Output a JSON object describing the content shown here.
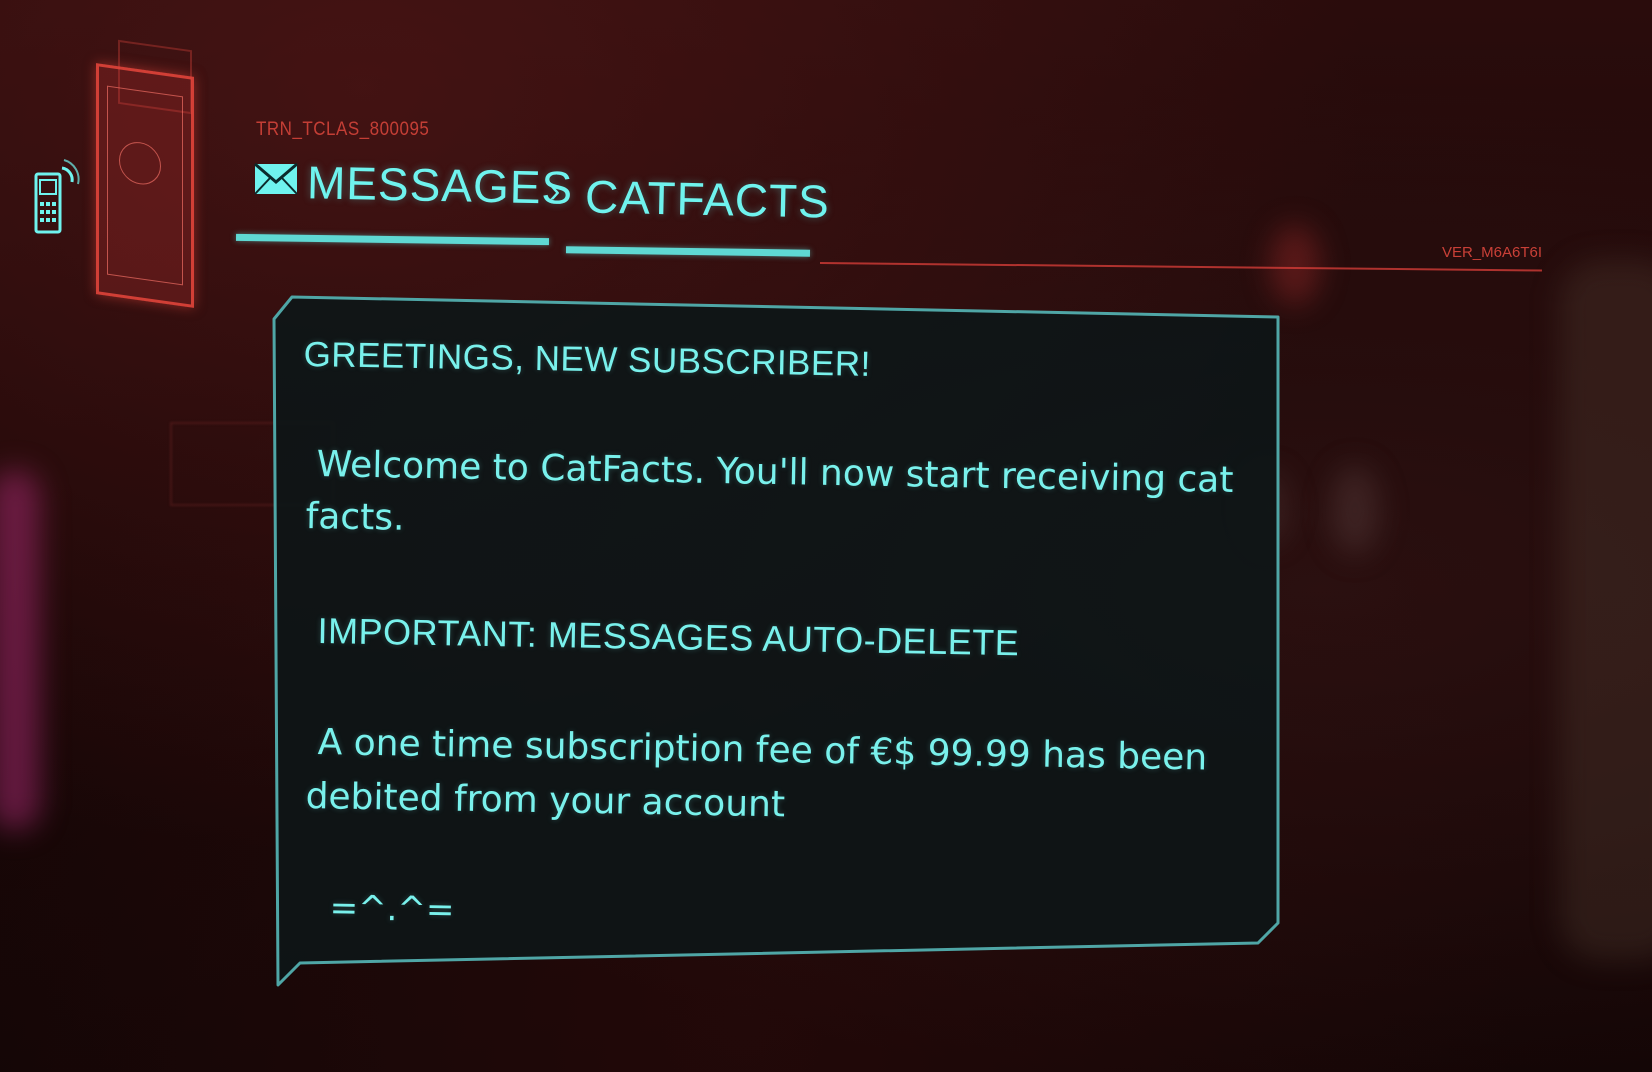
{
  "header": {
    "tracking_code": "TRN_TCLAS_800095",
    "breadcrumb": {
      "section": "MESSAGES",
      "separator": "›",
      "current": "CATFACTS"
    },
    "version_code": "VER_M6A6T6I"
  },
  "message": {
    "greeting": "GREETINGS, NEW SUBSCRIBER!",
    "welcome_line1": "Welcome to CatFacts. You'll now start receiving cat",
    "welcome_line2": "facts.",
    "important": "IMPORTANT: MESSAGES AUTO-DELETE",
    "fee_line1": "A one time subscription fee of €$ 99.99 has been",
    "fee_line2": "debited from your account",
    "emoticon": "=^.^="
  },
  "icons": {
    "phone": "phone-icon",
    "mail": "mail-icon",
    "holo_card": "holo-card-icon"
  },
  "colors": {
    "accent_cyan": "#6ff3ee",
    "accent_red": "#dc463c",
    "panel_bg": "#111819",
    "background": "#1d0808"
  }
}
